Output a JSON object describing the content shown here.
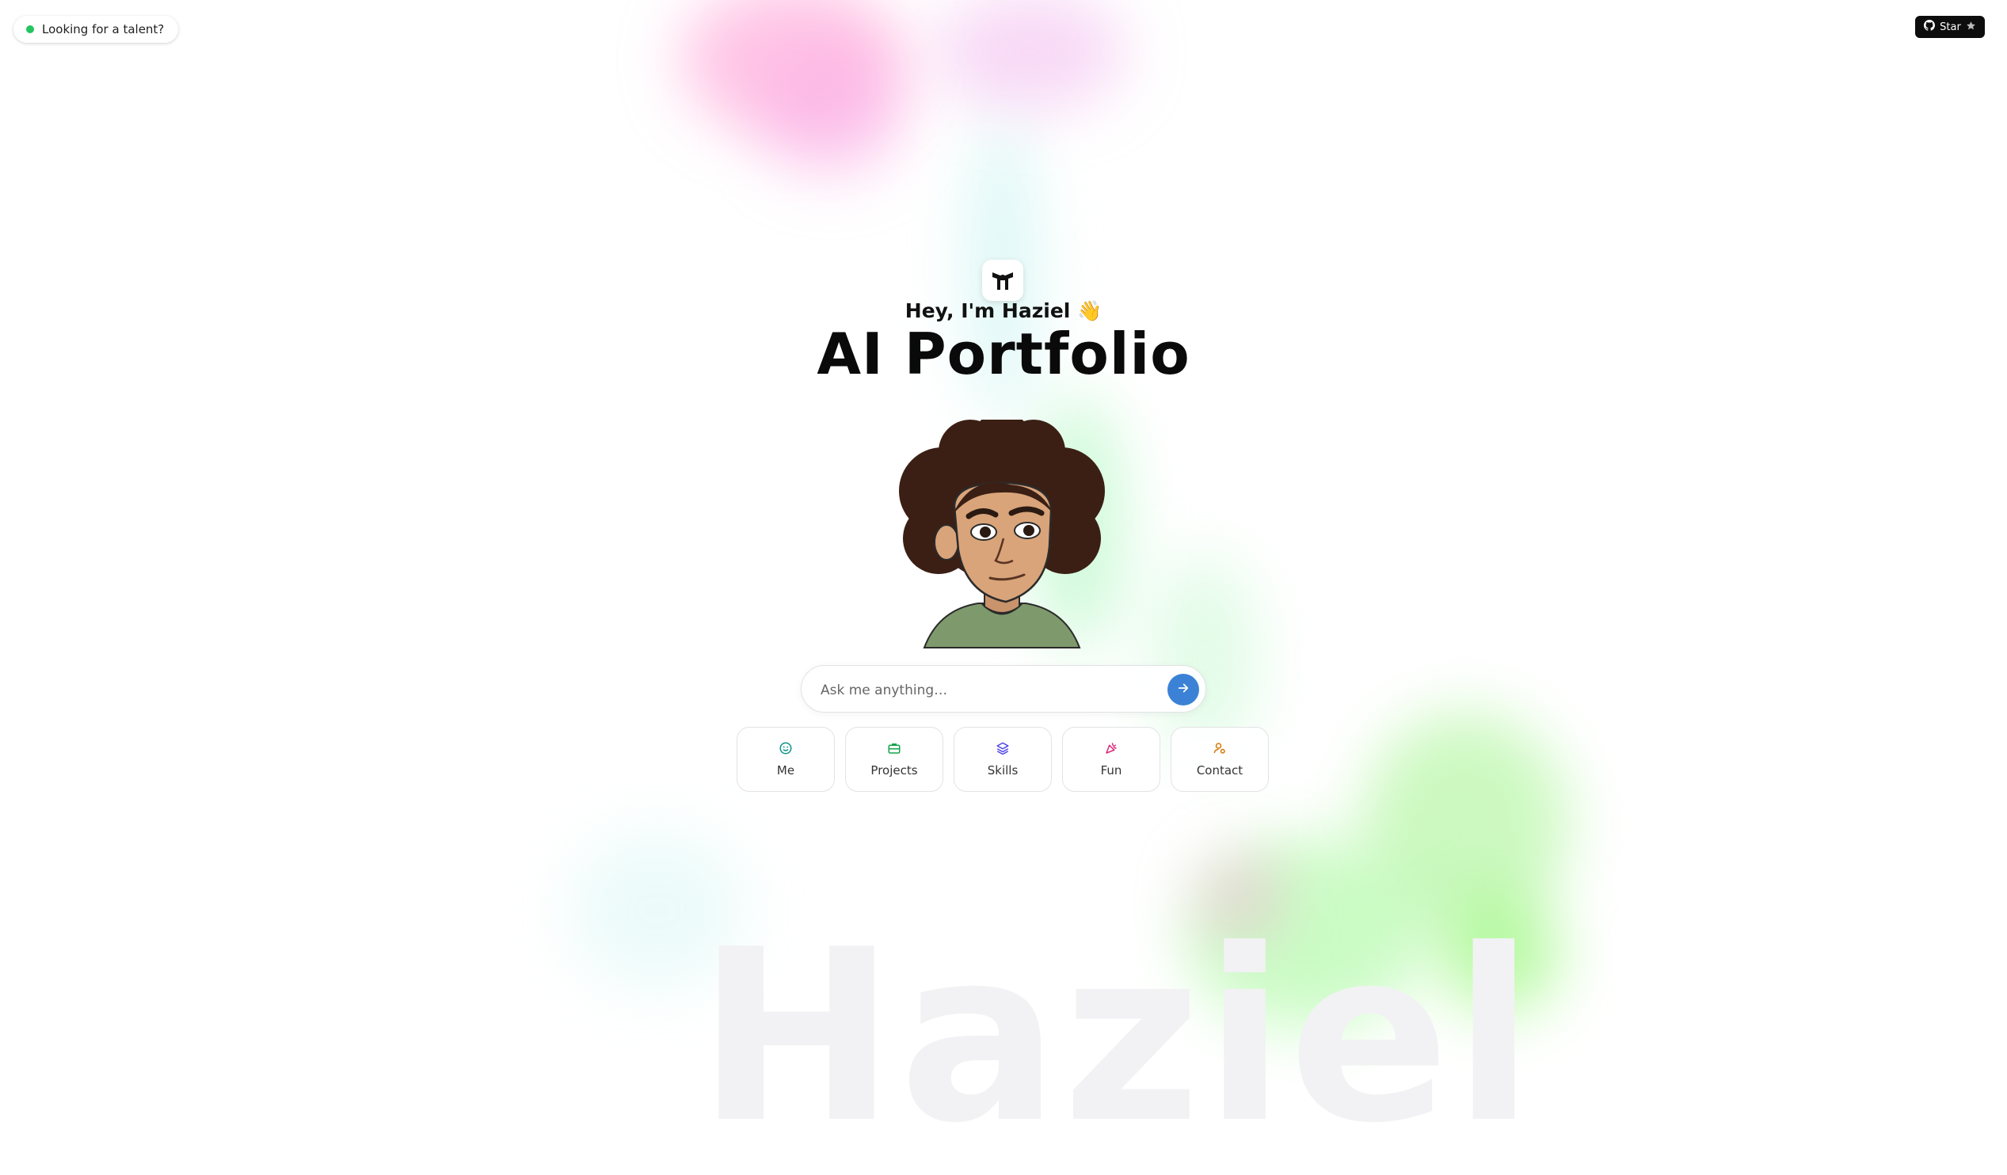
{
  "badge": {
    "label": "Looking for a talent?",
    "dot_color": "#22c55e"
  },
  "github": {
    "label": "Star",
    "icons": [
      "github-icon",
      "star-icon"
    ]
  },
  "hero": {
    "logo_icon": "portfolio-logo-icon",
    "greeting": "Hey, I'm Haziel 👋",
    "title": "AI Portfolio"
  },
  "chat": {
    "placeholder": "Ask me anything…",
    "send_icon": "arrow-right-icon",
    "accent": "#3b82d6"
  },
  "quick_actions": [
    {
      "label": "Me",
      "icon": "smile-icon",
      "color": "#0d9488"
    },
    {
      "label": "Projects",
      "icon": "briefcase-icon",
      "color": "#16a34a"
    },
    {
      "label": "Skills",
      "icon": "layers-icon",
      "color": "#4f46e5"
    },
    {
      "label": "Fun",
      "icon": "party-popper-icon",
      "color": "#db2777"
    },
    {
      "label": "Contact",
      "icon": "user-contact-icon",
      "color": "#d97706"
    }
  ],
  "watermark": "Haziel"
}
